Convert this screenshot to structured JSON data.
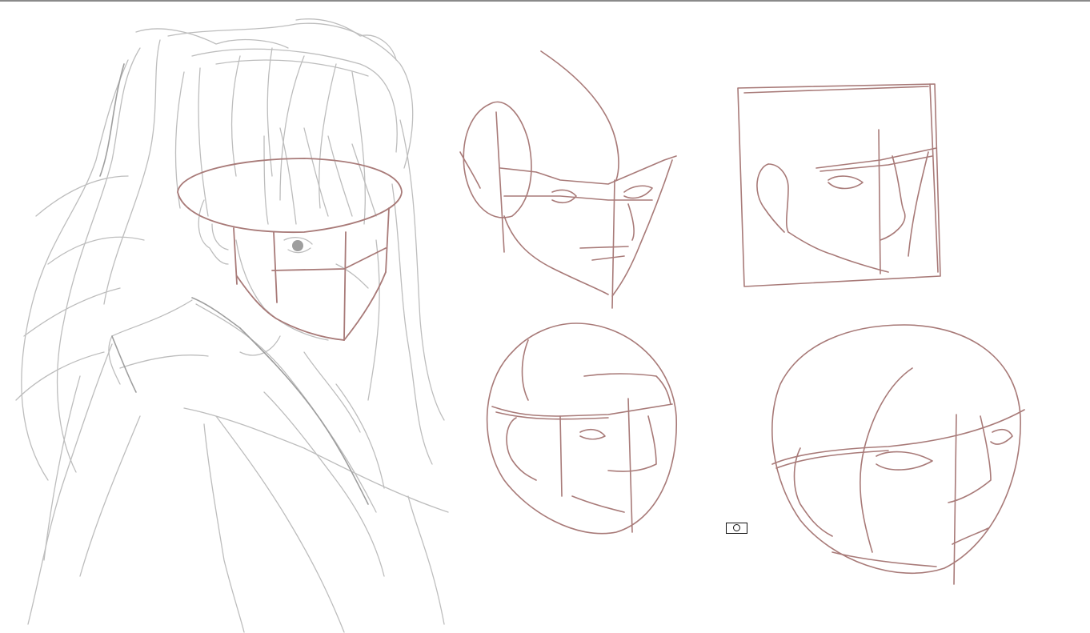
{
  "canvas": {
    "sketch_color": "#b9b9b9",
    "construction_color": "#a87a78",
    "background": "#ffffff"
  },
  "drawings": [
    {
      "name": "girl-portrait-sketch"
    },
    {
      "name": "head-study-profile-left"
    },
    {
      "name": "head-study-box"
    },
    {
      "name": "head-study-sphere-small"
    },
    {
      "name": "head-study-sphere-large"
    }
  ],
  "overlay": {
    "icon": "camera-icon"
  }
}
